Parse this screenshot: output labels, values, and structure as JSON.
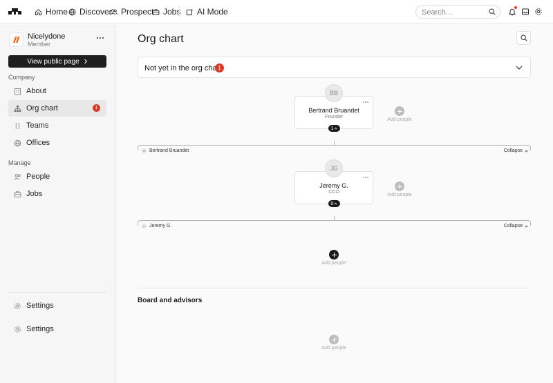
{
  "nav": {
    "home": "Home",
    "discover": "Discover",
    "prospect": "Prospect",
    "jobs": "Jobs",
    "ai_mode": "AI Mode"
  },
  "search": {
    "placeholder": "Search..."
  },
  "sidebar": {
    "org_name": "Nicelydone",
    "org_role": "Member",
    "view_public_page": "View public page",
    "company_label": "Company",
    "manage_label": "Manage",
    "items": [
      {
        "label": "About",
        "icon": "building-icon"
      },
      {
        "label": "Org chart",
        "icon": "org-chart-icon",
        "badge": "1"
      },
      {
        "label": "Teams",
        "icon": "teams-icon"
      },
      {
        "label": "Offices",
        "icon": "globe-icon"
      },
      {
        "label": "People",
        "icon": "people-icon"
      },
      {
        "label": "Jobs",
        "icon": "briefcase-icon"
      }
    ],
    "settings_1": "Settings",
    "settings_2": "Settings"
  },
  "main": {
    "title": "Org chart",
    "pending": {
      "label": "Not yet in the org chart",
      "count": "1"
    },
    "nodes": [
      {
        "initials": "BB",
        "name": "Bertrand Bruandet",
        "role": "Founder",
        "reports": "1"
      },
      {
        "initials": "JG",
        "name": "Jeremy G.",
        "role": "CCO",
        "reports": "0"
      }
    ],
    "branches": [
      {
        "initials": "BB",
        "name": "Bertrand Bruandet",
        "collapse": "Collapse"
      },
      {
        "initials": "JG",
        "name": "Jeremy G.",
        "collapse": "Collapse"
      }
    ],
    "add_people": "Add people",
    "board_title": "Board and advisors"
  },
  "colors": {
    "accent_red": "#d93a25",
    "dark": "#1f1f1f"
  }
}
